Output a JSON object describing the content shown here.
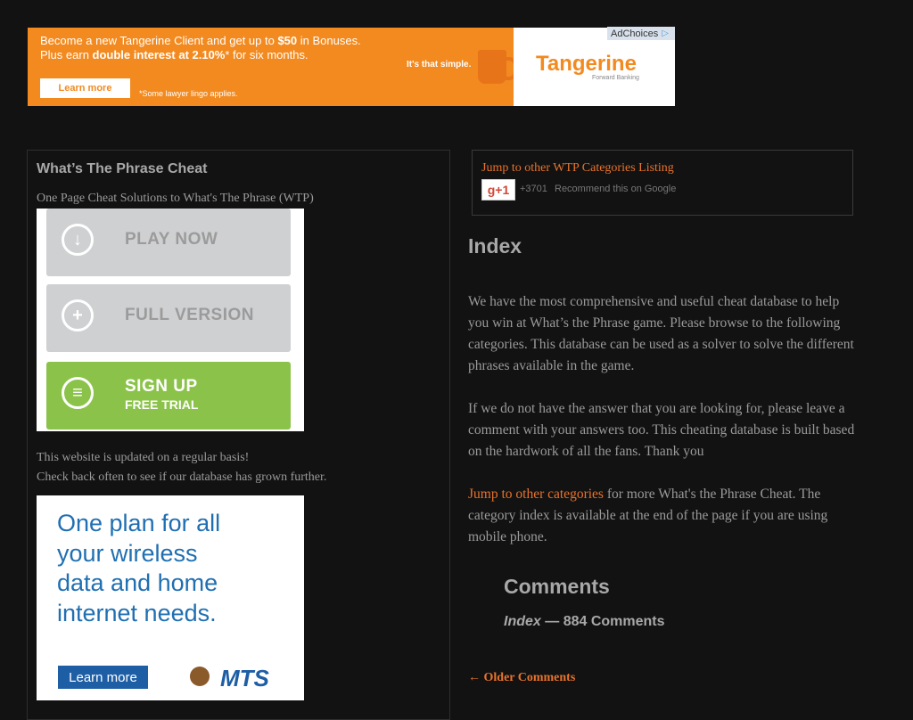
{
  "top_ad": {
    "line1_prefix": "Become a new Tangerine Client and get up to ",
    "line1_bold": "$50",
    "line1_suffix": " in Bonuses.",
    "line2_prefix": "Plus earn ",
    "line2_bold": "double interest at 2.10%",
    "line2_suffix": "* for six months.",
    "learn_more": "Learn more",
    "lawyer_note": "*Some lawyer lingo applies.",
    "tagline": "It's that simple.",
    "brand": "Tangerine",
    "brand_sub": "Forward Banking",
    "adchoices": "AdChoices",
    "accent_color": "#f28a20"
  },
  "left": {
    "site_title": "What’s The Phrase Cheat",
    "site_subtitle": "One Page Cheat Solutions to What's The Phrase (WTP)",
    "download_ad": {
      "play_now": "PLAY NOW",
      "full_version": "FULL VERSION",
      "sign_up": "SIGN UP",
      "free_trial": "FREE TRIAL"
    },
    "update_line1": "This website is updated on a regular basis!",
    "update_line2": "Check back often to see if our database has grown further.",
    "mts_ad": {
      "headline_l1": "One plan for all",
      "headline_l2": "your wireless",
      "headline_l3": "data and home",
      "headline_l4": "internet needs.",
      "learn_more": "Learn more",
      "logo": "MTS"
    }
  },
  "right": {
    "jump_link": "Jump to other WTP Categories Listing",
    "gplus_label": "g+1",
    "gplus_count": "+3701",
    "gplus_text": "Recommend this on Google",
    "index_title": "Index",
    "para1": "We have the most comprehensive and useful cheat database to help you win at What’s the Phrase game. Please browse to the following categories. This database can be used as a solver to solve the different phrases available in the game.",
    "para2": "If we do not have the answer that you are looking for, please leave a comment with your answers too. This cheating database is built based on the hardwork of all the fans. Thank you",
    "para3_link": "Jump to other categories",
    "para3_rest": " for more What's the Phrase Cheat. The category index is available at the end of the page if you are using mobile phone.",
    "comments_title": "Comments",
    "comments_index": "Index",
    "comments_count": " — 884 Comments",
    "older_comments": "← Older Comments",
    "link_color": "#e8732c"
  }
}
